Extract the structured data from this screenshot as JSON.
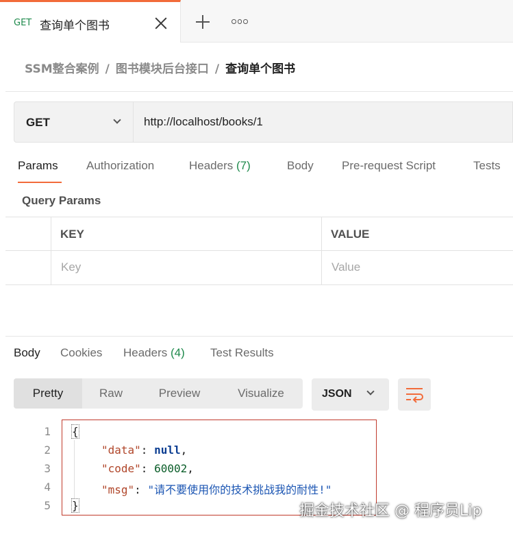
{
  "tab": {
    "method": "GET",
    "title": "查询单个图书"
  },
  "breadcrumb": {
    "items": [
      "SSM整合案例",
      "图书模块后台接口",
      "查询单个图书"
    ],
    "separator": "/"
  },
  "request": {
    "method": "GET",
    "url": "http://localhost/books/1"
  },
  "request_tabs": [
    {
      "label": "Params",
      "count": ""
    },
    {
      "label": "Authorization",
      "count": ""
    },
    {
      "label": "Headers",
      "count": "(7)"
    },
    {
      "label": "Body",
      "count": ""
    },
    {
      "label": "Pre-request Script",
      "count": ""
    },
    {
      "label": "Tests",
      "count": ""
    }
  ],
  "query_params": {
    "title": "Query Params",
    "columns": [
      "KEY",
      "VALUE"
    ],
    "placeholders": {
      "key": "Key",
      "value": "Value"
    }
  },
  "response_tabs": [
    {
      "label": "Body",
      "count": ""
    },
    {
      "label": "Cookies",
      "count": ""
    },
    {
      "label": "Headers",
      "count": "(4)"
    },
    {
      "label": "Test Results",
      "count": ""
    }
  ],
  "view_modes": [
    "Pretty",
    "Raw",
    "Preview",
    "Visualize"
  ],
  "format": "JSON",
  "response_body": {
    "line_numbers": [
      "1",
      "2",
      "3",
      "4",
      "5"
    ],
    "open_brace": "{",
    "close_brace": "}",
    "key_data": "\"data\"",
    "val_data": "null",
    "key_code": "\"code\"",
    "val_code": "60002",
    "key_msg": "\"msg\"",
    "val_msg": "\"请不要使用你的技术挑战我的耐性!\"",
    "colon": ": ",
    "comma": ","
  },
  "watermark": "掘金技术社区 @ 程序员Lip",
  "colors": {
    "accent": "#f26b3a",
    "count_green": "#1f8a4c",
    "highlight_border": "#c0392b"
  }
}
